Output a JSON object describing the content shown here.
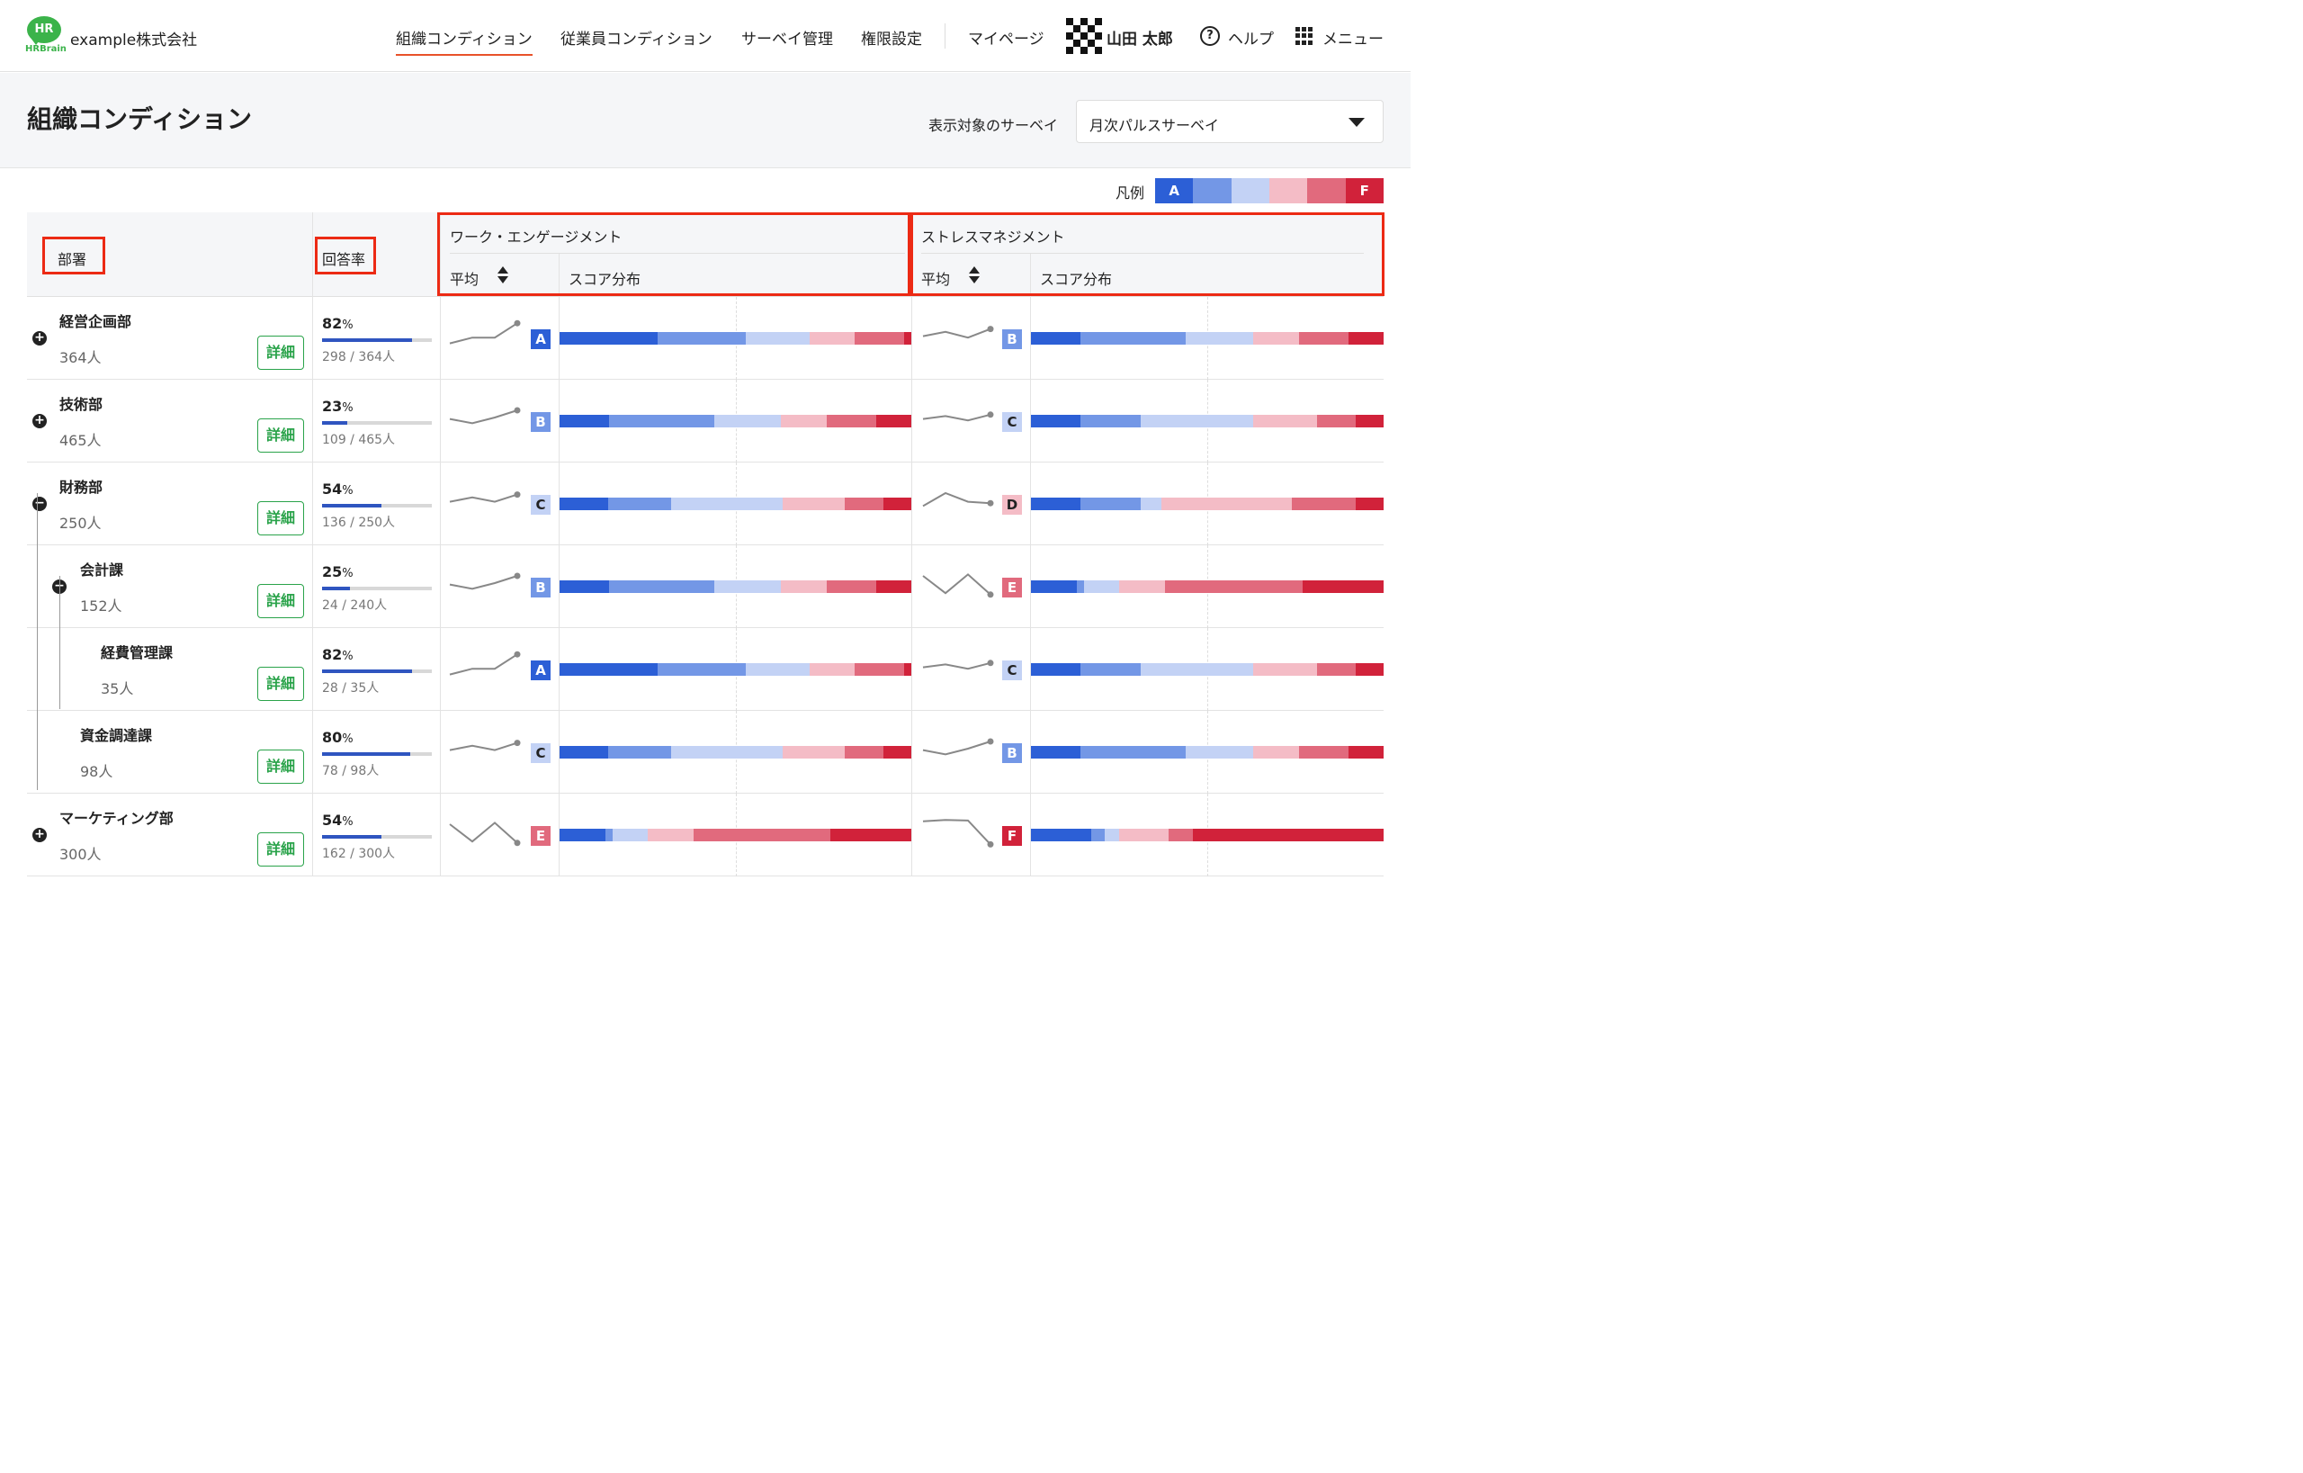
{
  "header": {
    "logo_text": "HR",
    "logo_brand": "HRBrain",
    "company": "example株式会社",
    "nav": [
      "組織コンディション",
      "従業員コンディション",
      "サーベイ管理",
      "権限設定",
      "マイページ"
    ],
    "user": "山田 太郎",
    "help": "ヘルプ",
    "menu": "メニュー"
  },
  "page": {
    "title": "組織コンディション",
    "survey_label": "表示対象のサーベイ",
    "survey_value": "月次パルスサーベイ"
  },
  "legend": {
    "label": "凡例",
    "first": "A",
    "last": "F",
    "colors": [
      "#2c5fd6",
      "#7397e6",
      "#c3d2f5",
      "#f4bcc6",
      "#e16a7d",
      "#d1223a"
    ]
  },
  "table": {
    "col_dept": "部署",
    "col_rate": "回答率",
    "group1": "ワーク・エンゲージメント",
    "group2": "ストレスマネジメント",
    "avg": "平均",
    "dist": "スコア分布",
    "detail_label": "詳細"
  },
  "rows": [
    {
      "name": "経営企画部",
      "count": "364人",
      "rate": "82",
      "rate_fill": 0.82,
      "rate_sub": "298 / 364人",
      "level": 0,
      "toggle": "+",
      "we_grade": "A",
      "we_dist": [
        28,
        25,
        18,
        13,
        14,
        2
      ],
      "we_spark": [
        0.2,
        0.4,
        0.4,
        0.9
      ],
      "sm_grade": "B",
      "sm_dist": [
        14,
        30,
        19,
        13,
        14,
        10
      ],
      "sm_spark": [
        0.45,
        0.6,
        0.4,
        0.7
      ]
    },
    {
      "name": "技術部",
      "count": "465人",
      "rate": "23",
      "rate_fill": 0.23,
      "rate_sub": "109 / 465人",
      "level": 0,
      "toggle": "+",
      "we_grade": "B",
      "we_dist": [
        14,
        30,
        19,
        13,
        14,
        10
      ],
      "we_spark": [
        0.45,
        0.3,
        0.5,
        0.75
      ],
      "sm_grade": "C",
      "sm_dist": [
        14,
        17,
        32,
        18,
        11,
        8
      ],
      "sm_spark": [
        0.45,
        0.55,
        0.4,
        0.6
      ]
    },
    {
      "name": "財務部",
      "count": "250人",
      "rate": "54",
      "rate_fill": 0.54,
      "rate_sub": "136 / 250人",
      "level": 0,
      "toggle": "-",
      "we_grade": "C",
      "we_dist": [
        14,
        18,
        32,
        18,
        11,
        8
      ],
      "we_spark": [
        0.45,
        0.6,
        0.45,
        0.7
      ],
      "sm_grade": "D",
      "sm_dist": [
        14,
        17,
        6,
        37,
        18,
        8
      ],
      "sm_spark": [
        0.3,
        0.75,
        0.45,
        0.4
      ]
    },
    {
      "name": "会計課",
      "count": "152人",
      "rate": "25",
      "rate_fill": 0.25,
      "rate_sub": "24 / 240人",
      "level": 1,
      "toggle": "-",
      "we_grade": "B",
      "we_dist": [
        14,
        30,
        19,
        13,
        14,
        10
      ],
      "we_spark": [
        0.45,
        0.3,
        0.5,
        0.75
      ],
      "sm_grade": "E",
      "sm_dist": [
        13,
        2,
        10,
        13,
        39,
        23
      ],
      "sm_spark": [
        0.75,
        0.15,
        0.8,
        0.1
      ]
    },
    {
      "name": "経費管理課",
      "count": "35人",
      "rate": "82",
      "rate_fill": 0.82,
      "rate_sub": "28 / 35人",
      "level": 2,
      "toggle": "",
      "we_grade": "A",
      "we_dist": [
        28,
        25,
        18,
        13,
        14,
        2
      ],
      "we_spark": [
        0.2,
        0.4,
        0.4,
        0.9
      ],
      "sm_grade": "C",
      "sm_dist": [
        14,
        17,
        32,
        18,
        11,
        8
      ],
      "sm_spark": [
        0.45,
        0.55,
        0.4,
        0.6
      ]
    },
    {
      "name": "資金調達課",
      "count": "98人",
      "rate": "80",
      "rate_fill": 0.8,
      "rate_sub": "78 / 98人",
      "level": 1,
      "toggle": "",
      "we_grade": "C",
      "we_dist": [
        14,
        18,
        32,
        18,
        11,
        8
      ],
      "we_spark": [
        0.45,
        0.6,
        0.45,
        0.7
      ],
      "sm_grade": "B",
      "sm_dist": [
        14,
        30,
        19,
        13,
        14,
        10
      ],
      "sm_spark": [
        0.45,
        0.3,
        0.5,
        0.75
      ]
    },
    {
      "name": "マーケティング部",
      "count": "300人",
      "rate": "54",
      "rate_fill": 0.54,
      "rate_sub": "162 / 300人",
      "level": 0,
      "toggle": "+",
      "we_grade": "E",
      "we_dist": [
        13,
        2,
        10,
        13,
        39,
        23
      ],
      "we_spark": [
        0.75,
        0.15,
        0.8,
        0.1
      ],
      "sm_grade": "F",
      "sm_dist": [
        17,
        4,
        4,
        14,
        7,
        54
      ],
      "sm_spark": [
        0.85,
        0.9,
        0.88,
        0.05
      ]
    }
  ]
}
